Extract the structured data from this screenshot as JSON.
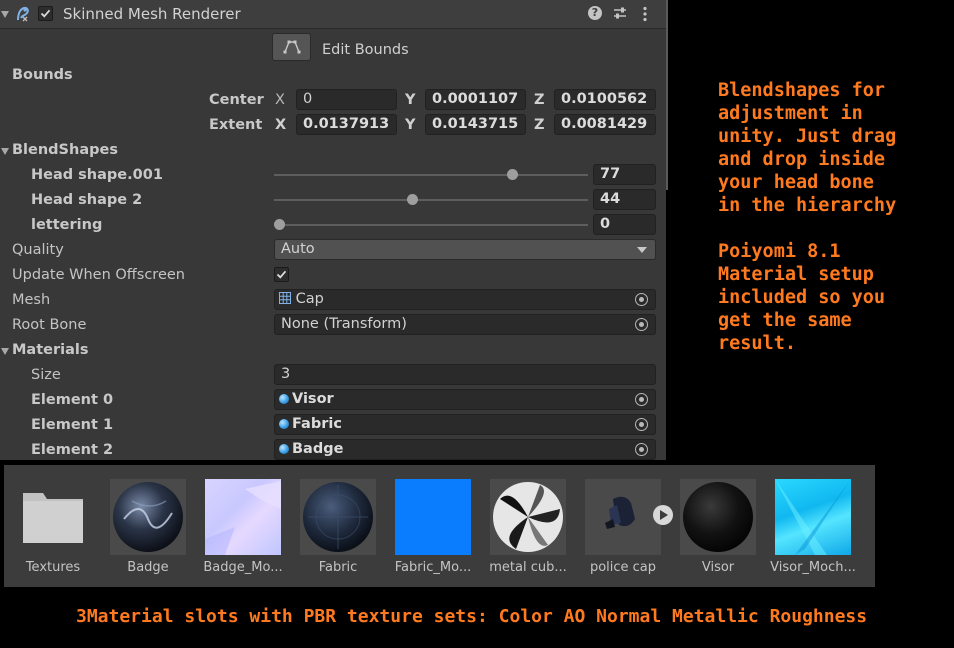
{
  "component": {
    "title": "Skinned Mesh Renderer",
    "enabled": true,
    "icons": [
      "skinned-mesh-icon",
      "help-icon",
      "presets-icon",
      "kebab-menu-icon"
    ]
  },
  "edit_bounds": {
    "label": "Edit Bounds"
  },
  "bounds": {
    "label": "Bounds",
    "center": {
      "label": "Center",
      "x": "0",
      "y": "0.0001107",
      "z": "0.0100562"
    },
    "extent": {
      "label": "Extent",
      "x": "0.0137913",
      "y": "0.0143715",
      "z": "0.0081429"
    },
    "axis_x": "X",
    "axis_y": "Y",
    "axis_z": "Z"
  },
  "blendshapes": {
    "label": "BlendShapes",
    "items": [
      {
        "name": "Head shape.001",
        "value": "77",
        "fraction": 0.77
      },
      {
        "name": "Head shape 2",
        "value": "44",
        "fraction": 0.44
      },
      {
        "name": "lettering",
        "value": "0",
        "fraction": 0.0
      }
    ]
  },
  "quality": {
    "label": "Quality",
    "value": "Auto"
  },
  "update_offscreen": {
    "label": "Update When Offscreen",
    "checked": true
  },
  "mesh": {
    "label": "Mesh",
    "value": "Cap"
  },
  "root_bone": {
    "label": "Root Bone",
    "value": "None (Transform)"
  },
  "materials": {
    "label": "Materials",
    "size_label": "Size",
    "size": "3",
    "elements": [
      {
        "label": "Element 0",
        "value": "Visor"
      },
      {
        "label": "Element 1",
        "value": "Fabric"
      },
      {
        "label": "Element 2",
        "value": "Badge"
      }
    ]
  },
  "assets": [
    {
      "name": "Textures",
      "kind": "folder"
    },
    {
      "name": "Badge",
      "kind": "material"
    },
    {
      "name": "Badge_Mo...",
      "kind": "texture"
    },
    {
      "name": "Fabric",
      "kind": "material"
    },
    {
      "name": "Fabric_Mo...",
      "kind": "texture"
    },
    {
      "name": "metal cub...",
      "kind": "cubemap"
    },
    {
      "name": "police cap",
      "kind": "model"
    },
    {
      "name": "Visor",
      "kind": "material"
    },
    {
      "name": "Visor_Moch...",
      "kind": "texture"
    }
  ],
  "annotation_right": {
    "block1": "Blendshapes for\nadjustment in\nunity. Just drag\nand drop inside\nyour head bone\nin the hierarchy",
    "block2": "Poiyomi 8.1\nMaterial setup\nincluded so you\nget the same\nresult."
  },
  "caption": "3Material slots with PBR texture sets: Color AO Normal Metallic Roughness",
  "colors": {
    "annotation": "#ff7a1f",
    "inspector_bg": "#383838"
  }
}
